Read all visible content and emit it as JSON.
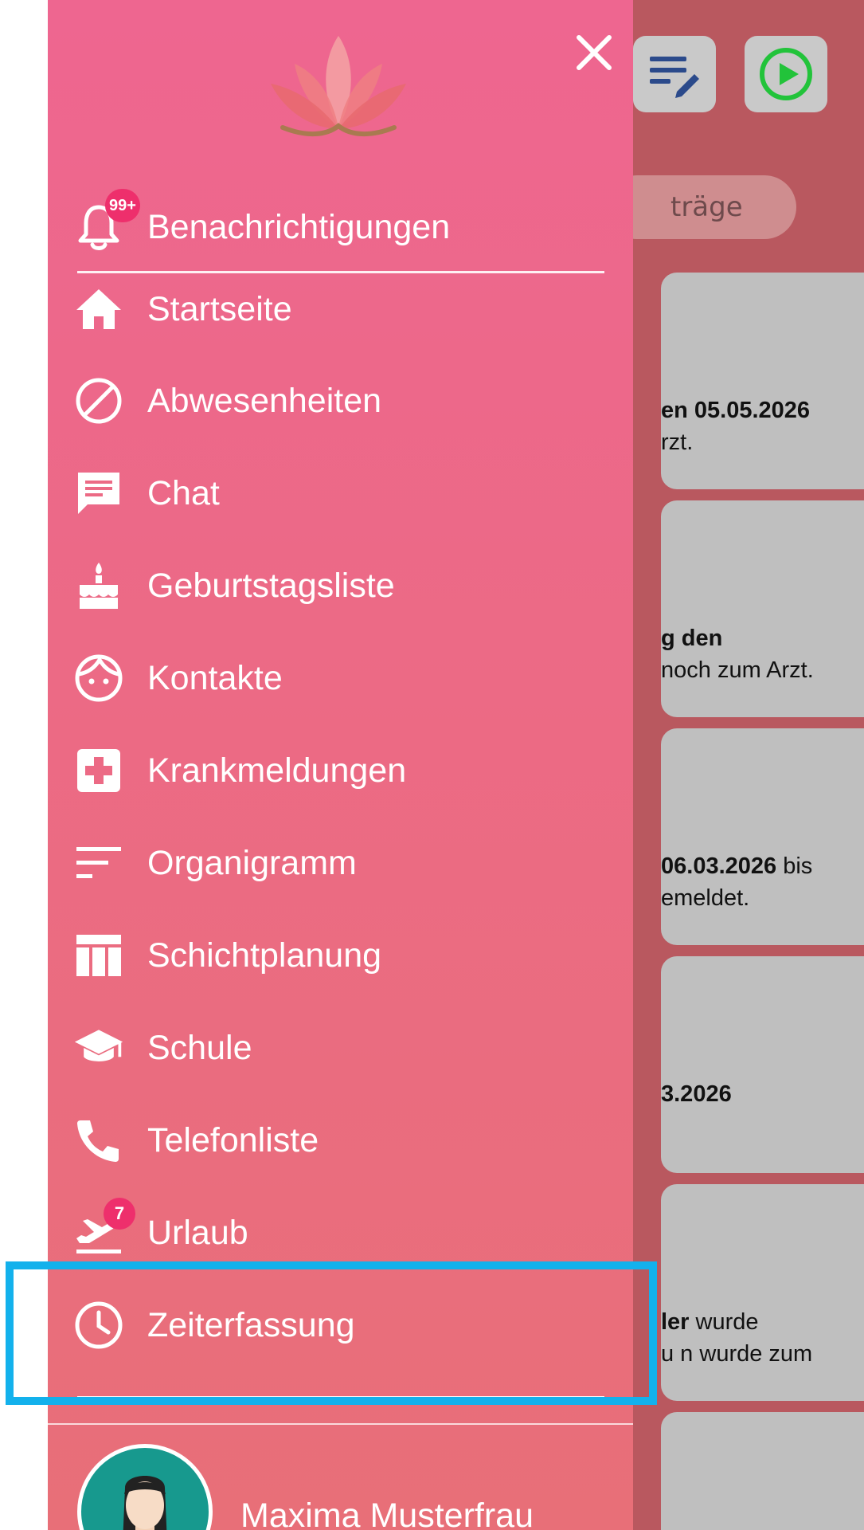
{
  "drawer": {
    "menu": [
      {
        "id": "benachrichtigungen",
        "label": "Benachrichtigungen",
        "icon": "bell-icon",
        "badge": "99+"
      },
      {
        "id": "startseite",
        "label": "Startseite",
        "icon": "home-icon"
      },
      {
        "id": "abwesenheiten",
        "label": "Abwesenheiten",
        "icon": "block-icon"
      },
      {
        "id": "chat",
        "label": "Chat",
        "icon": "chat-icon"
      },
      {
        "id": "geburtstagsliste",
        "label": "Geburtstagsliste",
        "icon": "cake-icon"
      },
      {
        "id": "kontakte",
        "label": "Kontakte",
        "icon": "face-icon"
      },
      {
        "id": "krankmeldungen",
        "label": "Krankmeldungen",
        "icon": "medical-cross-icon"
      },
      {
        "id": "organigramm",
        "label": "Organigramm",
        "icon": "sort-lines-icon"
      },
      {
        "id": "schichtplanung",
        "label": "Schichtplanung",
        "icon": "table-icon"
      },
      {
        "id": "schule",
        "label": "Schule",
        "icon": "graduation-cap-icon"
      },
      {
        "id": "telefonliste",
        "label": "Telefonliste",
        "icon": "phone-icon"
      },
      {
        "id": "urlaub",
        "label": "Urlaub",
        "icon": "flight-takeoff-icon",
        "badge": "7"
      },
      {
        "id": "zeiterfassung",
        "label": "Zeiterfassung",
        "icon": "clock-icon"
      }
    ],
    "profile": {
      "name": "Maxima Musterfrau"
    }
  },
  "background": {
    "chip_label": "träge",
    "cards": [
      {
        "line1_bold": "en 05.05.2026",
        "line1_rest": "",
        "line2": "rzt."
      },
      {
        "line1_bold": "g den",
        "line1_rest": "",
        "line2": " noch zum Arzt."
      },
      {
        "line1_bold": "06.03.2026",
        "line1_rest": " bis",
        "line2": "emeldet."
      },
      {
        "line1_bold": "3.2026",
        "line1_rest": "",
        "line2": ""
      },
      {
        "line1_bold": "ler",
        "line1_rest": " wurde",
        "line2": "u n wurde zum"
      }
    ]
  },
  "colors": {
    "drawer_top": "#ee6690",
    "drawer_bottom": "#e86f78",
    "badge": "#ee2f6c",
    "highlight": "#13b1ec",
    "play_green": "#22c33a",
    "list_icon_blue": "#2b4a8b"
  }
}
